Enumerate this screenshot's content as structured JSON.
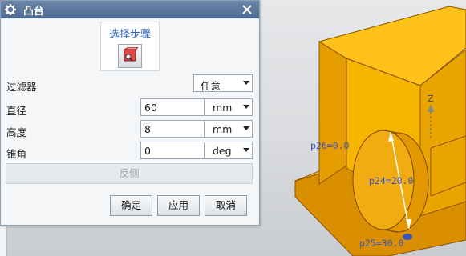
{
  "dialog": {
    "title": "凸台",
    "title_icon": "gear-icon",
    "close_icon": "close-icon",
    "step_label": "选择步骤",
    "step_icon": "face-select-icon",
    "filter": {
      "label": "过滤器",
      "value": "任意"
    },
    "diameter": {
      "label": "直径",
      "value": "60",
      "unit": "mm"
    },
    "height": {
      "label": "高度",
      "value": "8",
      "unit": "mm"
    },
    "taper": {
      "label": "锥角",
      "value": "0",
      "unit": "deg"
    },
    "reverse_label": "反侧",
    "ok_label": "确定",
    "apply_label": "应用",
    "cancel_label": "取消"
  },
  "viewport": {
    "axis_label": "Z",
    "dim_p26": "p26=0.0",
    "dim_p24": "p24=20.0",
    "dim_p25": "p25=30.0",
    "colors": {
      "part": "#f5b400",
      "edge": "#b36a00",
      "dimension": "#3a54b8"
    }
  }
}
